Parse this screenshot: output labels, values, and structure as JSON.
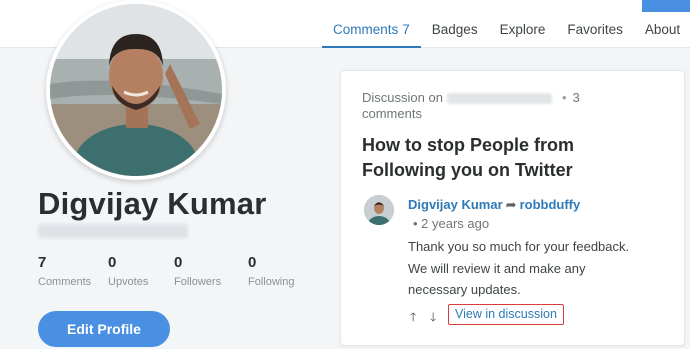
{
  "nav": {
    "tabs": [
      {
        "label": "Comments",
        "count": "7"
      },
      {
        "label": "Badges"
      },
      {
        "label": "Explore"
      },
      {
        "label": "Favorites"
      },
      {
        "label": "About"
      }
    ]
  },
  "profile": {
    "name": "Digvijay Kumar",
    "stats": [
      {
        "value": "7",
        "label": "Comments"
      },
      {
        "value": "0",
        "label": "Upvotes"
      },
      {
        "value": "0",
        "label": "Followers"
      },
      {
        "value": "0",
        "label": "Following"
      }
    ],
    "edit_button": "Edit Profile"
  },
  "discussion": {
    "prefix": "Discussion on",
    "separator": "•",
    "comment_count": "3 comments",
    "title": "How to stop People from Following you on Twitter",
    "comment": {
      "author": "Digvijay Kumar",
      "reply_icon": "➦",
      "reply_to": "robbduffy",
      "time": "• 2 years ago",
      "body": "Thank you so much for your feedback. We will review it and make any necessary updates.",
      "upvote_glyph": "🡑",
      "downvote_glyph": "🡓",
      "view_link": "View in discussion"
    }
  },
  "colors": {
    "accent": "#4a90e2",
    "link": "#2e7ab8",
    "highlight_border": "#d93a3a"
  }
}
